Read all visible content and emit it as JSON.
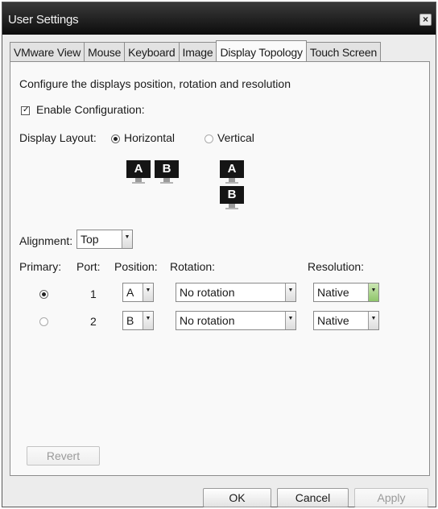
{
  "window": {
    "title": "User Settings",
    "close_glyph": "×"
  },
  "tabs": [
    {
      "label": "VMware View"
    },
    {
      "label": "Mouse"
    },
    {
      "label": "Keyboard"
    },
    {
      "label": "Image"
    },
    {
      "label": "Display Topology",
      "active": true
    },
    {
      "label": "Touch Screen"
    }
  ],
  "panel": {
    "description": "Configure the displays position, rotation and resolution",
    "enable_label": "Enable Configuration:",
    "enable_checked": true,
    "check_glyph": "✓",
    "layout_label": "Display Layout:",
    "horizontal_label": "Horizontal",
    "vertical_label": "Vertical",
    "layout_selected": "Horizontal",
    "monitors": {
      "a": "A",
      "b": "B"
    },
    "alignment_label": "Alignment:",
    "alignment_value": "Top",
    "columns": {
      "primary": "Primary:",
      "port": "Port:",
      "position": "Position:",
      "rotation": "Rotation:",
      "resolution": "Resolution:"
    },
    "rows": [
      {
        "primary": true,
        "port": "1",
        "position": "A",
        "rotation": "No rotation",
        "resolution": "Native"
      },
      {
        "primary": false,
        "port": "2",
        "position": "B",
        "rotation": "No rotation",
        "resolution": "Native"
      }
    ],
    "dropdown_arrow": "▼",
    "revert_label": "Revert"
  },
  "footer": {
    "ok_label": "OK",
    "cancel_label": "Cancel",
    "apply_label": "Apply"
  },
  "colors": {
    "titlebar": "#0c0c0c",
    "focused_arrow": "#8fc66b"
  },
  "icons": {
    "close": "close-icon",
    "dropdown": "chevron-down-icon"
  }
}
